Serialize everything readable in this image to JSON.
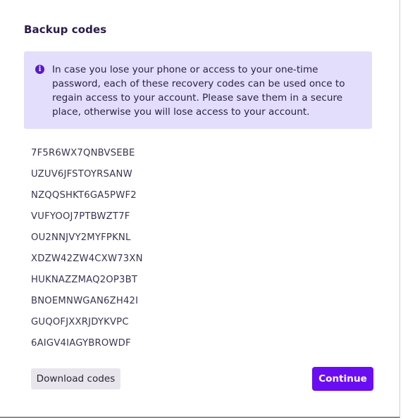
{
  "dialog": {
    "title": "Backup codes",
    "info": {
      "icon": "info-icon",
      "icon_glyph": "i",
      "text": "In case you lose your phone or access to your one-time password, each of these recovery codes can be used once to regain access to your account. Please save them in a secure place, otherwise you will lose access to your account."
    },
    "codes": [
      "7F5R6WX7QNBVSEBE",
      "UZUV6JFSTOYRSANW",
      "NZQQSHKT6GA5PWF2",
      "VUFYOOJ7PTBWZT7F",
      "OU2NNJVY2MYFPKNL",
      "XDZW42ZW4CXW73XN",
      "HUKNAZZMAQ2OP3BT",
      "BNOEMNWGAN6ZH42I",
      "GUQOFJXXRJDYKVPC",
      "6AIGV4IAGYBROWDF"
    ],
    "buttons": {
      "download_label": "Download codes",
      "continue_label": "Continue"
    }
  },
  "colors": {
    "accent": "#6b0df2",
    "info_background": "#e2defc",
    "title": "#2a1a4a"
  }
}
